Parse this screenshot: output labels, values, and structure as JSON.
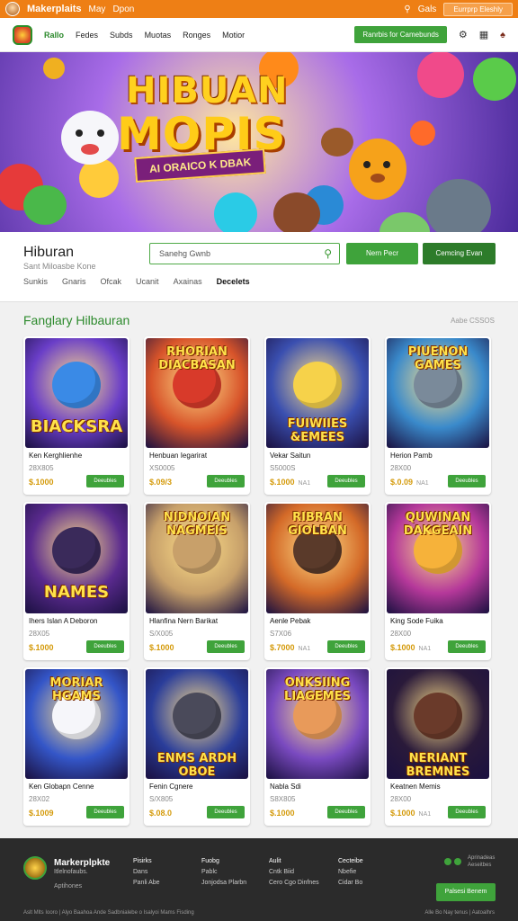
{
  "topbar": {
    "brand": "Makerplaits",
    "link1": "May",
    "link2": "Dpon",
    "link3": "Gals",
    "cta": "Eurrprp Eleshly",
    "bg_color": "#ee7f15"
  },
  "nav": {
    "brand": "Rallo",
    "items": [
      "Fedes",
      "Subds",
      "Muotas",
      "Ronges",
      "Motior"
    ],
    "cta": "Ranrbis for Camebunds",
    "accent": "#3fa33b"
  },
  "hero": {
    "title_line1": "HIBUAN",
    "title_line2": "MOPIS",
    "ribbon": "AI ORAICO K DBAK"
  },
  "infobar": {
    "title": "Hiburan",
    "subtitle": "Sant Miloasbe Kone",
    "search_placeholder": "Sanehg Gwnb",
    "button1": "Nern Pecr",
    "button2": "Cemcing Evan",
    "tabs": [
      "Sunkis",
      "Gnaris",
      "Ofcak",
      "Ucanit",
      "Axainas",
      "Decelets"
    ]
  },
  "section": {
    "title": "Fanglary Hilbauran",
    "meta": "Aabe CSSOS"
  },
  "cards": [
    {
      "label": "BIACKSRA",
      "name": "Ken Kerghlienhe",
      "count": "28X805",
      "price": "$.1000",
      "extra": "",
      "buy": "Deeubles",
      "bg": "#6a3ec8"
    },
    {
      "label": "RHORIAN DIACBASAN",
      "name": "Henbuan Iegarirat",
      "count": "XS0005",
      "price": "$.09/3",
      "extra": "",
      "buy": "Deeubles",
      "bg": "#d8542a"
    },
    {
      "label": "FUIWIIES &EMEES",
      "name": "Vekar Saitun",
      "count": "S5000S",
      "price": "$.1000",
      "extra": "NA1",
      "buy": "Deeubles",
      "bg": "#3a4fb0"
    },
    {
      "label": "PIUENON GAMES",
      "name": "Herion Pamb",
      "count": "28X00",
      "price": "$.0.09",
      "extra": "NA1",
      "buy": "Deeubles",
      "bg": "#3a8acb"
    },
    {
      "label": "NAMES",
      "name": "Ihers Islan A Deboron",
      "count": "28X05",
      "price": "$.1000",
      "extra": "",
      "buy": "Deeubles",
      "bg": "#5a2a8e"
    },
    {
      "label": "NIDNOIAN NAGMEIS",
      "name": "Hlanfina Nern Barikat",
      "count": "S/X005",
      "price": "$.1000",
      "extra": "",
      "buy": "Deeubles",
      "bg": "#c7a06a"
    },
    {
      "label": "RIBRAN GIOLBAN",
      "name": "Aenle Pebak",
      "count": "S7X06",
      "price": "$.7000",
      "extra": "NA1",
      "buy": "Deeubles",
      "bg": "#d46a28"
    },
    {
      "label": "QUWINAN DAKGEAIN",
      "name": "King Sode Fuika",
      "count": "28X00",
      "price": "$.1000",
      "extra": "NA1",
      "buy": "Deeubles",
      "bg": "#b5389a"
    },
    {
      "label": "MORIAR HGAMS",
      "name": "Ken Globapn Cenne",
      "count": "28X02",
      "price": "$.1009",
      "extra": "",
      "buy": "Deeubles",
      "bg": "#3456c8"
    },
    {
      "label": "ENMS ARDH OBOE",
      "name": "Fenin Cgnere",
      "count": "S/X805",
      "price": "$.08.0",
      "extra": "",
      "buy": "Deeubles",
      "bg": "#2a3d9a"
    },
    {
      "label": "ONKSIING LIAGEMES",
      "name": "Nabla Sdi",
      "count": "S8X805",
      "price": "$.1000",
      "extra": "",
      "buy": "Deeubles",
      "bg": "#7a4ac0"
    },
    {
      "label": "NERIANT BREMNES",
      "name": "Keatnen Memis",
      "count": "28X00",
      "price": "$.1000",
      "extra": "NA1",
      "buy": "Deeubles",
      "bg": "#2a1a3a"
    }
  ],
  "footer": {
    "brand": "Markerplpkte",
    "tagline": "Itlelnofaubs.",
    "sub": "Aptihones",
    "cols": [
      {
        "head": "Pisirks",
        "items": [
          "Dans",
          "Panli Abe"
        ]
      },
      {
        "head": "Fuobg",
        "items": [
          "Pablc",
          "Jonjodsa Plarbn"
        ]
      },
      {
        "head": "Aulit",
        "items": [
          "Cntk Biid",
          "Cero Cgo Dinfnes"
        ]
      },
      {
        "head": "Cecteibe",
        "items": [
          "Nbefie",
          "Cidar Bo"
        ]
      }
    ],
    "social_label": "Aprinadeas Aeseitbes",
    "cta": "Palsesi Benem",
    "copyright": "Aslt Mlts Iooro | Alyo Baahoa Ande Sadbnialebe o Isalyoi Mams Fisding",
    "copyright_right": "Alle Bo Nay tenus | Aatoalhrs"
  }
}
